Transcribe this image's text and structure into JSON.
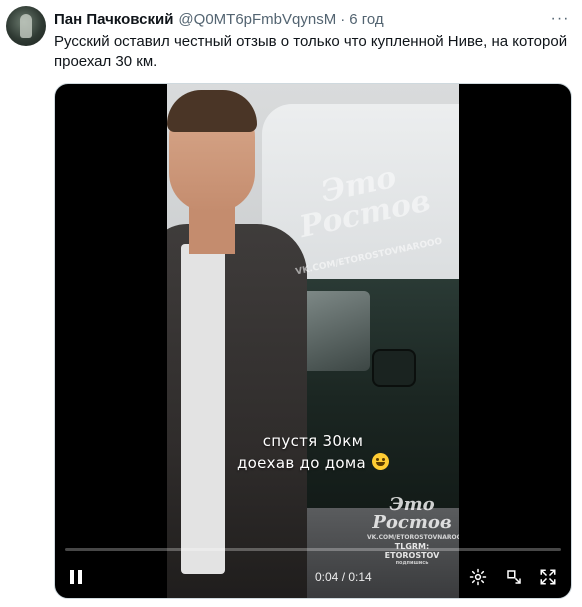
{
  "author": {
    "name": "Пан Пачковский",
    "handle": "@Q0MT6pFmbVqynsM",
    "separator": "·",
    "time": "6 год"
  },
  "tweet_text": "Русский оставил честный отзыв о только что купленной Ниве, на которой проехал 30 км.",
  "more_icon": "···",
  "video": {
    "watermark_logo": "Это Ростов",
    "watermark_url_top": "VK.COM/ETOROSTOVNAROOO",
    "caption_line1": "спустя 30км",
    "caption_line2": "доехав до дома",
    "caption_emoji": "grinning-sweat-emoji",
    "watermark_bottom_logo": "Это Ростов",
    "watermark_bottom_url": "VK.COM/ETOROSTOVNAROOO",
    "watermark_bottom_tg": "TLGRM: ETOROSTOV",
    "watermark_bottom_sub": "подпишись",
    "time_display": "0:04 / 0:14",
    "progress": 0.0
  },
  "icons": [
    "pause-icon",
    "settings-gear-icon",
    "fullscreen-exit-icon",
    "fullscreen-icon"
  ],
  "colors": {
    "accent": "#1d9bf0",
    "text": "#0f1419",
    "muted": "#536471"
  }
}
